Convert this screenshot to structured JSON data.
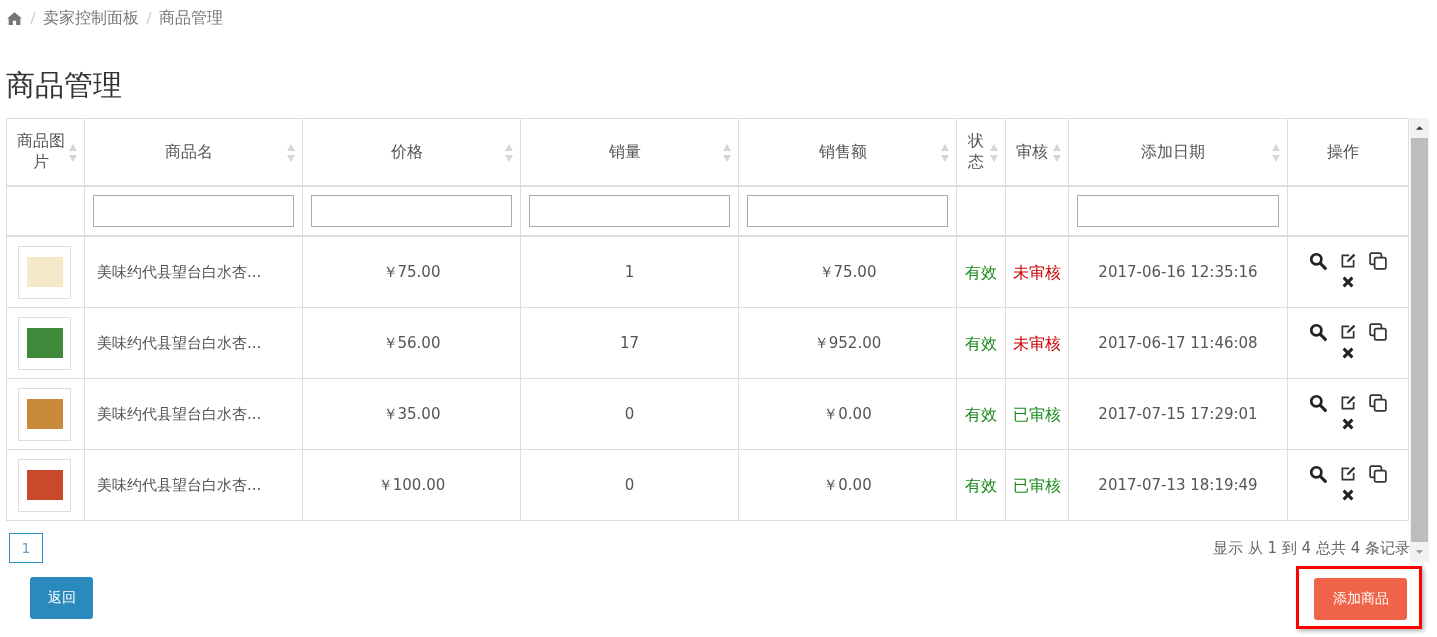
{
  "breadcrumb": [
    "卖家控制面板",
    "商品管理"
  ],
  "title": "商品管理",
  "table": {
    "columns": [
      {
        "label": "商品图片",
        "sortable": true,
        "filter": false
      },
      {
        "label": "商品名",
        "sortable": true,
        "filter": true
      },
      {
        "label": "价格",
        "sortable": true,
        "filter": true
      },
      {
        "label": "销量",
        "sortable": true,
        "filter": true
      },
      {
        "label": "销售额",
        "sortable": true,
        "filter": true
      },
      {
        "label": "状态",
        "sortable": true,
        "filter": false
      },
      {
        "label": "审核",
        "sortable": true,
        "filter": false
      },
      {
        "label": "添加日期",
        "sortable": true,
        "filter": true
      },
      {
        "label": "操作",
        "sortable": false,
        "filter": false
      }
    ],
    "rows": [
      {
        "name": "美味约代县望台白水杏...",
        "price": "￥75.00",
        "sales": "1",
        "revenue": "￥75.00",
        "status": "有效",
        "review": "未审核",
        "approved": false,
        "date": "2017-06-16 12:35:16"
      },
      {
        "name": "美味约代县望台白水杏...",
        "price": "￥56.00",
        "sales": "17",
        "revenue": "￥952.00",
        "status": "有效",
        "review": "未审核",
        "approved": false,
        "date": "2017-06-17 11:46:08"
      },
      {
        "name": "美味约代县望台白水杏...",
        "price": "￥35.00",
        "sales": "0",
        "revenue": "￥0.00",
        "status": "有效",
        "review": "已审核",
        "approved": true,
        "date": "2017-07-15 17:29:01"
      },
      {
        "name": "美味约代县望台白水杏...",
        "price": "￥100.00",
        "sales": "0",
        "revenue": "￥0.00",
        "status": "有效",
        "review": "已审核",
        "approved": true,
        "date": "2017-07-13 18:19:49"
      }
    ]
  },
  "pagination": {
    "pages": [
      {
        "label": "1",
        "selected": true
      }
    ],
    "info": "显示 从 1 到 4 总共 4 条记录"
  },
  "buttons": {
    "back": "返回",
    "add": "添加商品"
  }
}
